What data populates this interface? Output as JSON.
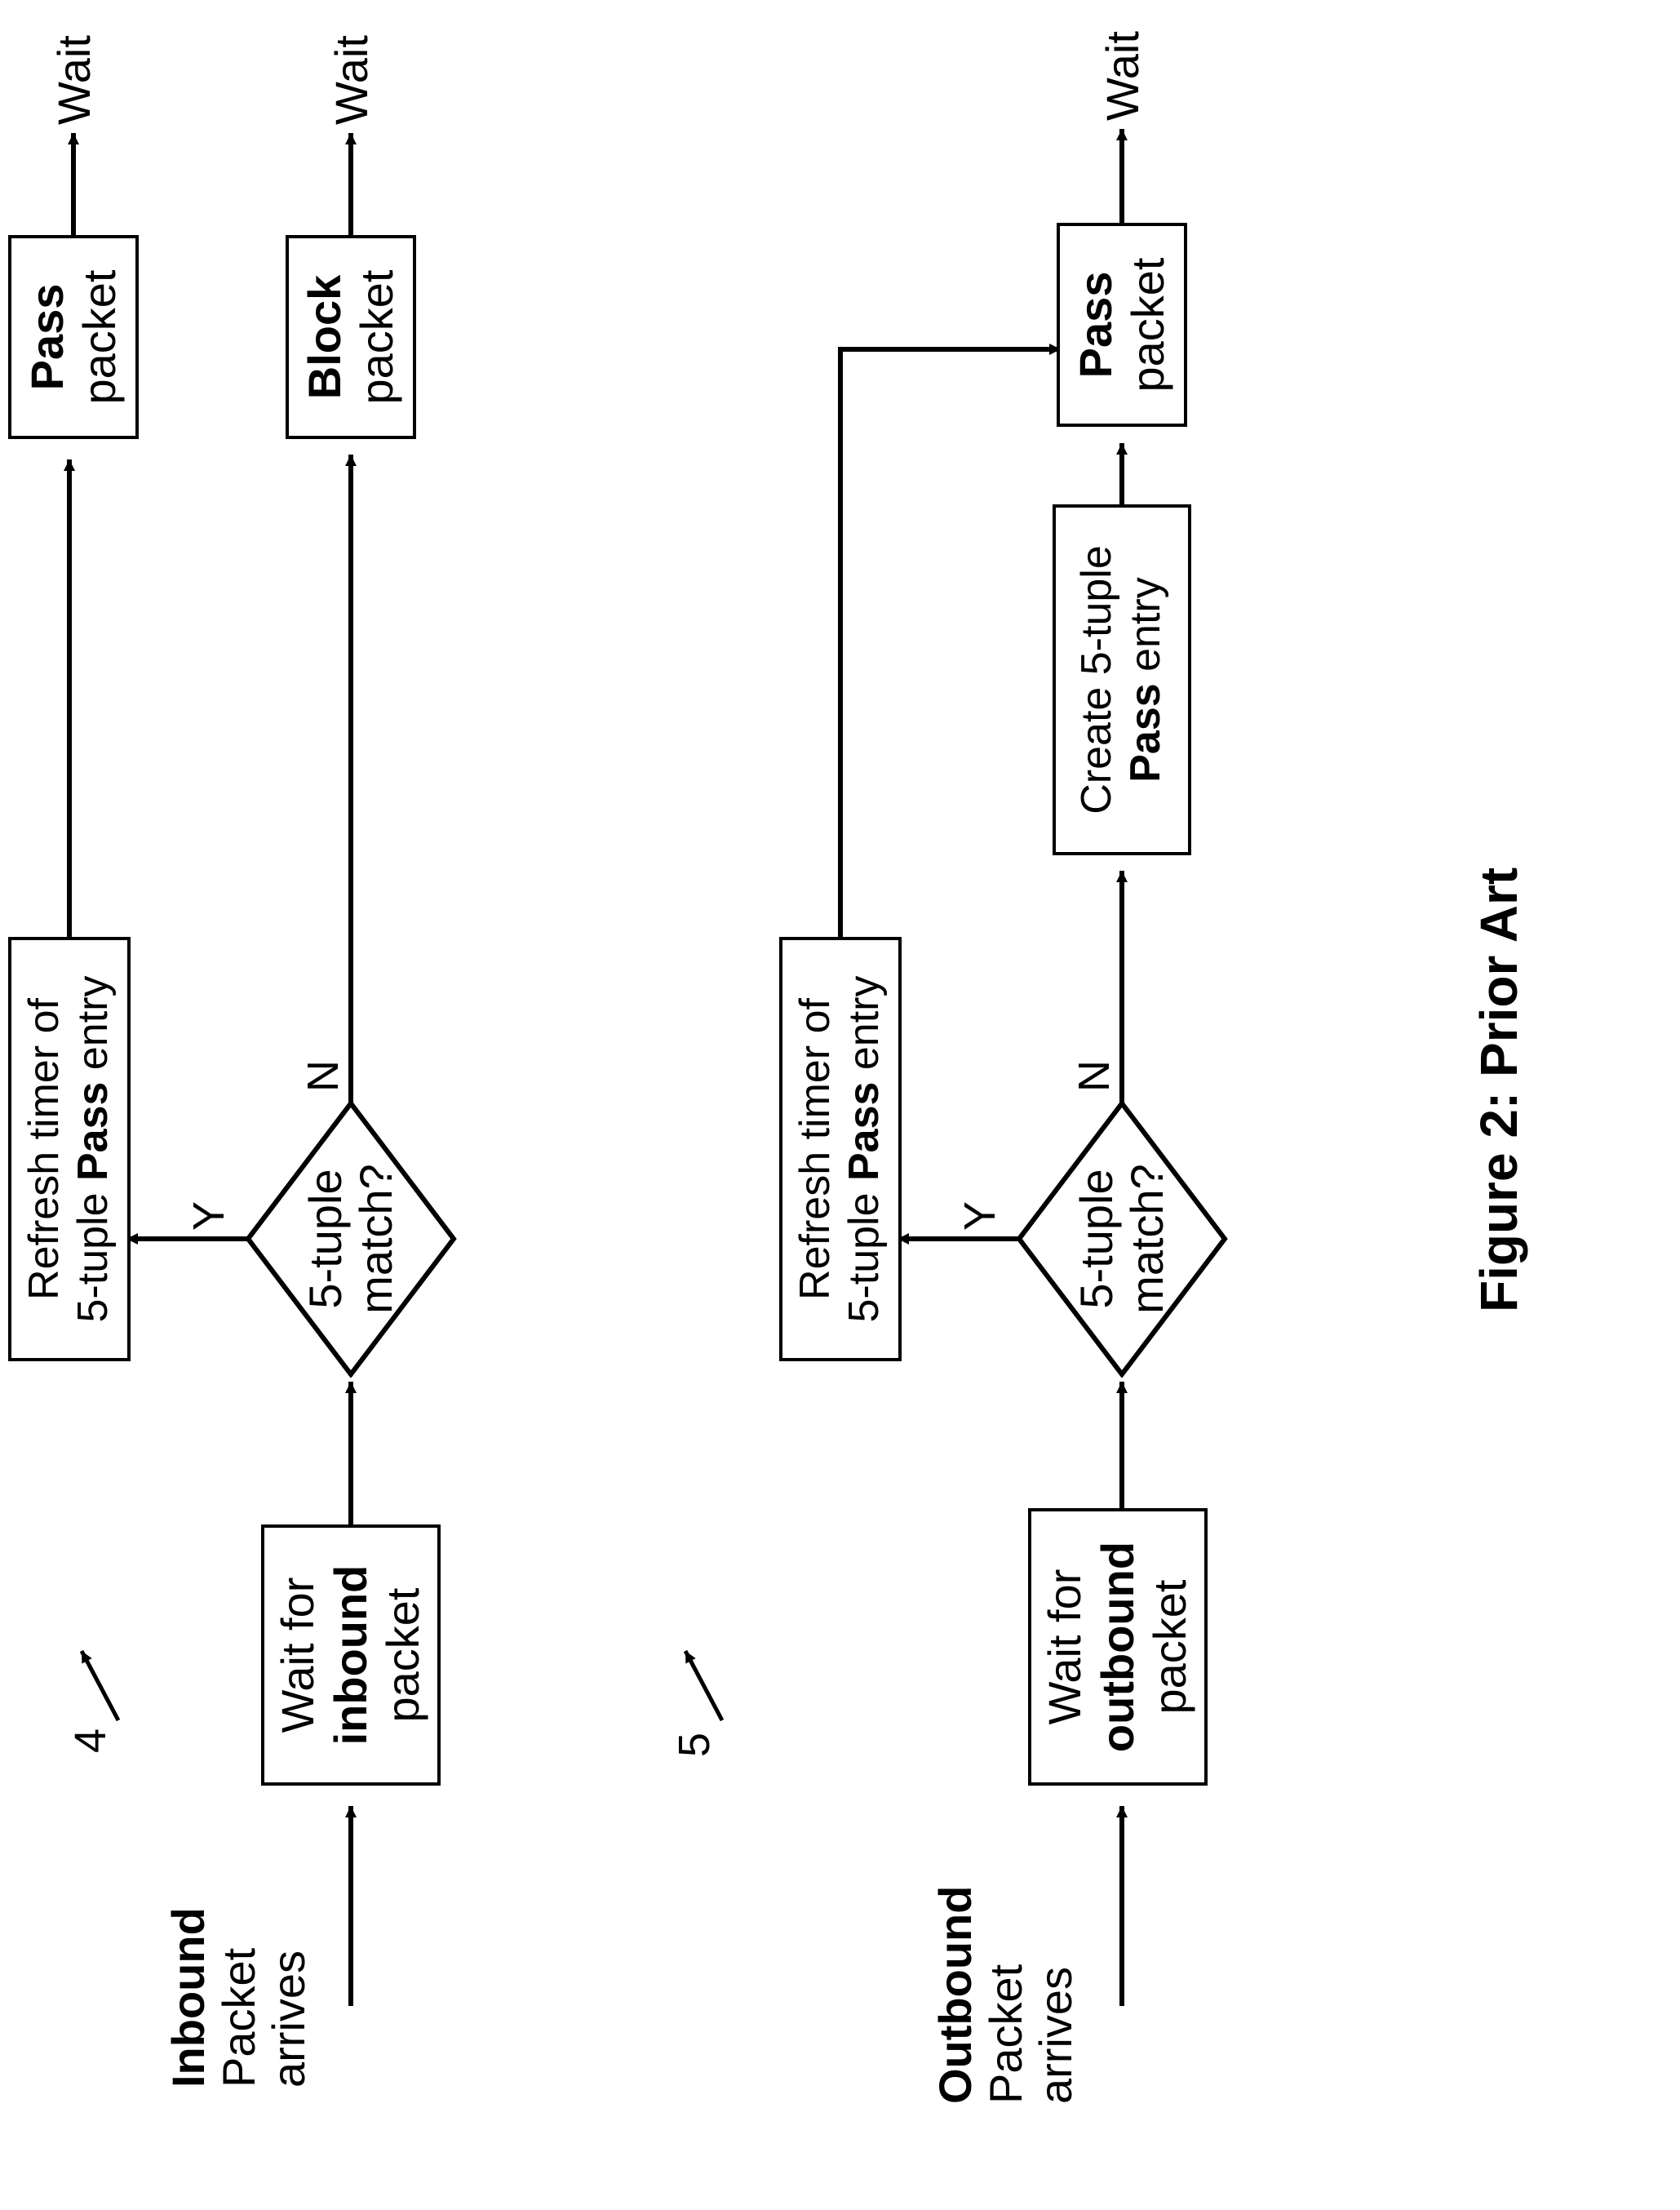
{
  "caption": "Figure 2: Prior Art",
  "refs": {
    "inbound": "4",
    "outbound": "5"
  },
  "yn": {
    "y": "Y",
    "n": "N"
  },
  "terminals": {
    "wait": "Wait"
  },
  "inbound": {
    "incoming_label_bold": "Inbound",
    "incoming_label_l2": "Packet",
    "incoming_label_l3": "arrives",
    "wait_box_l1": "Wait for",
    "wait_box_bold": "inbound",
    "wait_box_l3": "packet",
    "decision_l1": "5-tuple",
    "decision_l2": "match?",
    "refresh_l1": "Refresh timer of",
    "refresh_l2a": "5-tuple ",
    "refresh_l2_bold": "Pass",
    "refresh_l2b": " entry",
    "pass_bold": "Pass",
    "pass_l2": "packet",
    "block_bold": "Block",
    "block_l2": "packet"
  },
  "outbound": {
    "incoming_label_bold": "Outbound",
    "incoming_label_l2": "Packet",
    "incoming_label_l3": "arrives",
    "wait_box_l1": "Wait for",
    "wait_box_bold": "outbound",
    "wait_box_l3": "packet",
    "decision_l1": "5-tuple",
    "decision_l2": "match?",
    "refresh_l1": "Refresh timer of",
    "refresh_l2a": "5-tuple ",
    "refresh_l2_bold": "Pass",
    "refresh_l2b": " entry",
    "create_l1": "Create 5-tuple",
    "create_bold": "Pass",
    "create_l2b": " entry",
    "pass_bold": "Pass",
    "pass_l2": "packet"
  }
}
